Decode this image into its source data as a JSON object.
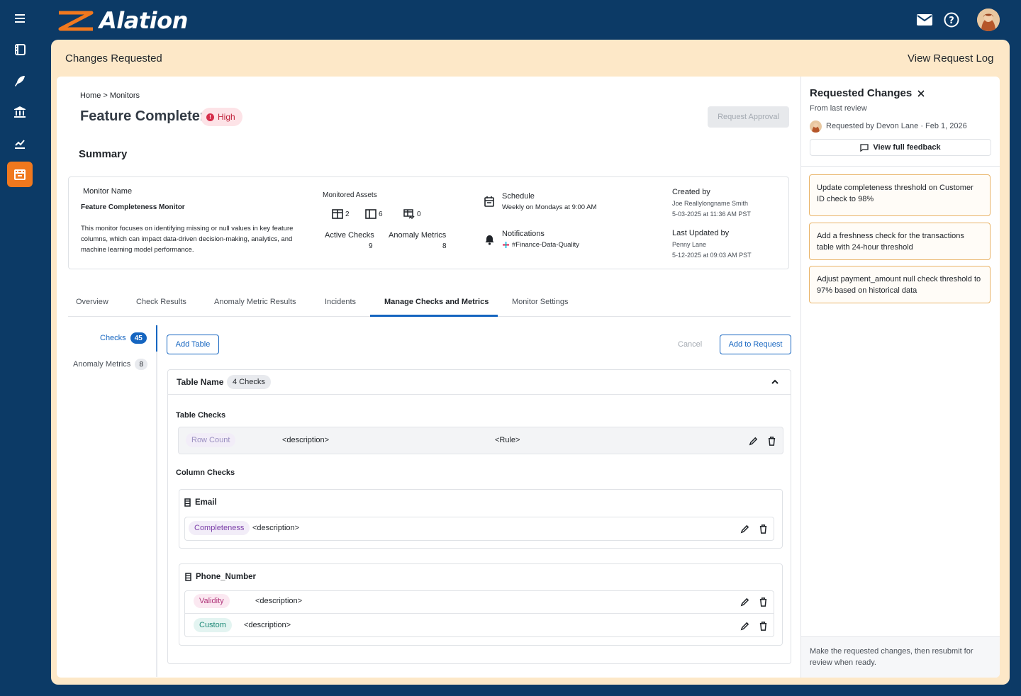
{
  "brand": {
    "name": "Alation",
    "accent": "#f0781e",
    "nav_bg": "#0c3a66",
    "banner_bg": "#fde8c8",
    "primary": "#1565c0"
  },
  "rail": {
    "icons": [
      "menu-icon",
      "book-icon",
      "feather-icon",
      "library-icon",
      "chart-icon",
      "storefront-icon"
    ],
    "active": "storefront-icon"
  },
  "topbar": {
    "icons": [
      "mail-icon",
      "help-icon",
      "user-avatar"
    ]
  },
  "banner": {
    "title": "Changes Requested",
    "view_log": "View Request Log"
  },
  "header": {
    "breadcrumb": "Home > Monitors",
    "title": "Feature Completeness Monitor",
    "priority": "High",
    "request_approval": "Request Approval",
    "summary_heading": "Summary"
  },
  "summary": {
    "monitor_name_label": "Monitor Name",
    "monitor_name": "Feature Completeness Monitor",
    "description": "This monitor focuses on identifying missing or null values in key feature columns, which can impact data-driven decision-making, analytics, and machine learning model performance.",
    "monitored_assets_label": "Monitored Assets",
    "assets": {
      "tables": "2",
      "columns": "6",
      "metrics": "0"
    },
    "active_checks_label": "Active Checks",
    "active_checks": "9",
    "anomaly_metrics_label": "Anomaly Metrics",
    "anomaly_metrics": "8",
    "schedule_label": "Schedule",
    "schedule": "Weekly on Mondays at 9:00 AM",
    "notifications_label": "Notifications",
    "notifications": "#Finance-Data-Quality",
    "created_by_label": "Created by",
    "created_by": "Joe Reallylongname Smith",
    "created_at": "5-03-2025 at 11:36 AM PST",
    "updated_by_label": "Last Updated by",
    "updated_by": "Penny Lane",
    "updated_at": "5-12-2025 at 09:03 AM PST"
  },
  "tabs": [
    "Overview",
    "Check Results",
    "Anomaly Metric Results",
    "Incidents",
    "Manage Checks and Metrics",
    "Monitor Settings"
  ],
  "active_tab": "Manage Checks and Metrics",
  "sidenav": {
    "checks_label": "Checks",
    "checks_count": "45",
    "anomaly_label": "Anomaly Metrics",
    "anomaly_count": "8"
  },
  "actions": {
    "add_table": "Add Table",
    "cancel": "Cancel",
    "add_to_request": "Add to Request"
  },
  "table_section": {
    "name": "Table Name",
    "checks_badge": "4 Checks",
    "table_checks_label": "Table Checks",
    "row_check": {
      "type": "Row Count",
      "description": "<description>",
      "rule": "<Rule>"
    },
    "column_checks_label": "Column Checks",
    "columns": [
      {
        "name": "Email",
        "checks": [
          {
            "type": "Completeness",
            "description": "<description>"
          }
        ]
      },
      {
        "name": "Phone_Number",
        "checks": [
          {
            "type": "Validity",
            "description": "<description>"
          },
          {
            "type": "Custom",
            "description": "<description>"
          }
        ]
      }
    ]
  },
  "panel": {
    "title": "Requested Changes",
    "subtitle": "From last review",
    "requested_by": "Requested by Devon Lane · Feb 1, 2026",
    "view_feedback": "View full feedback",
    "changes": [
      "Update completeness threshold on Customer ID check to 98%",
      "Add a freshness check for the transactions table with 24-hour threshold",
      "Adjust payment_amount null check threshold to 97% based on historical data"
    ],
    "footer": "Make the requested changes, then resubmit for review when ready."
  }
}
